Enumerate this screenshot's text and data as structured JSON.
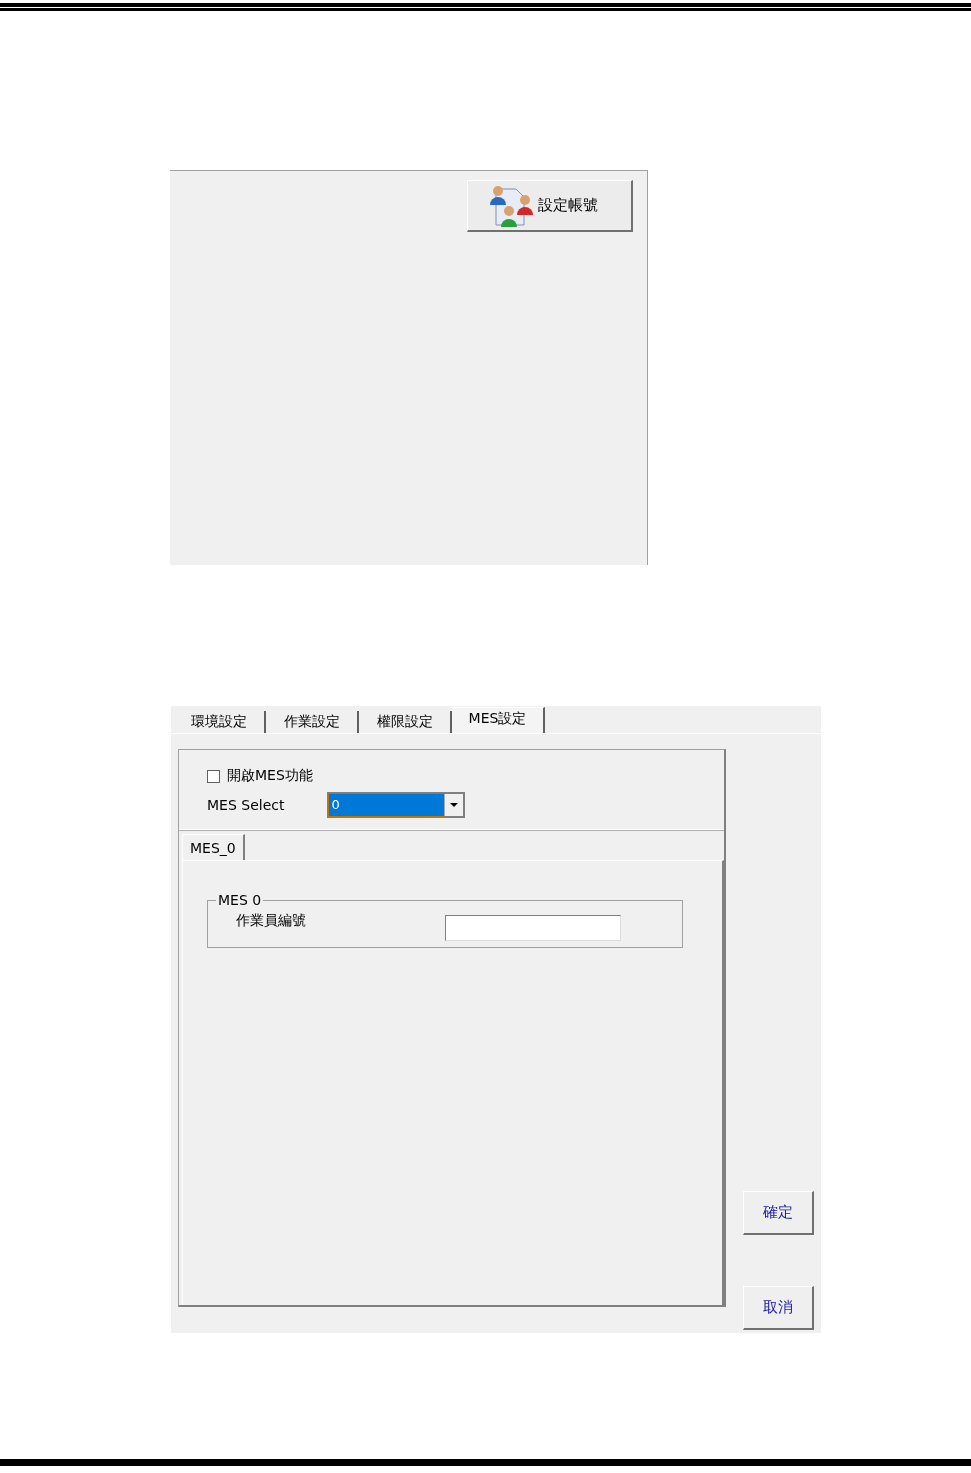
{
  "account_panel": {
    "button": "設定帳號"
  },
  "settings_dialog": {
    "tabs": [
      {
        "label": "環境設定",
        "selected": false
      },
      {
        "label": "作業設定",
        "selected": false
      },
      {
        "label": "權限設定",
        "selected": false
      },
      {
        "label": "MES設定",
        "selected": true
      }
    ],
    "enable_mes": {
      "label": "開啟MES功能",
      "checked": false
    },
    "mes_select": {
      "label": "MES Select",
      "value": "0"
    },
    "sub_tabs": [
      {
        "label": "MES_0",
        "selected": true
      }
    ],
    "group": {
      "title": "MES 0",
      "field_label": "作業員編號"
    },
    "buttons": [
      "確定",
      "取消"
    ]
  }
}
